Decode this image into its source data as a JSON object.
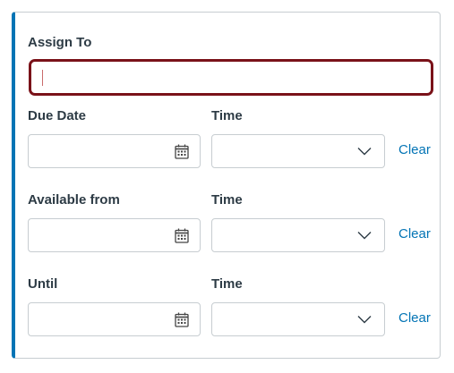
{
  "assign": {
    "label": "Assign To",
    "value": ""
  },
  "rows": [
    {
      "date_label": "Due Date",
      "time_label": "Time",
      "clear_label": "Clear"
    },
    {
      "date_label": "Available from",
      "time_label": "Time",
      "clear_label": "Clear"
    },
    {
      "date_label": "Until",
      "time_label": "Time",
      "clear_label": "Clear"
    }
  ],
  "colors": {
    "accent": "#0374b5",
    "focus_border": "#7a1219",
    "text": "#2d3b45",
    "input_border": "#c7cdd1"
  },
  "icons": {
    "date": "calendar-icon",
    "time": "chevron-down-icon"
  }
}
